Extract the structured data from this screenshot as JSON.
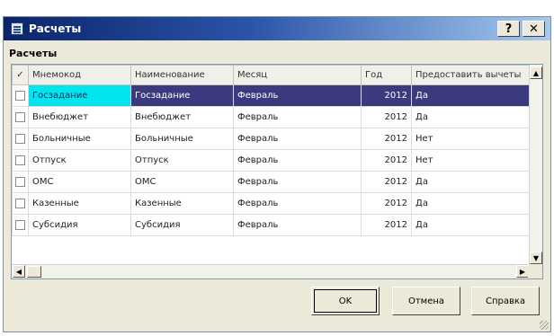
{
  "window": {
    "title": "Расчеты",
    "help_label": "?",
    "close_label": "✕",
    "icon": "app-grid-icon"
  },
  "section_label": "Расчеты",
  "grid": {
    "check_header": "✓",
    "columns": [
      "Мнемокод",
      "Наименование",
      "Месяц",
      "Год",
      "Предоставить вычеты"
    ],
    "rows": [
      {
        "mnemo": "Госзадание",
        "name": "Госзадание",
        "month": "Февраль",
        "year": "2012",
        "flag": "Да",
        "selected": true
      },
      {
        "mnemo": "Внебюджет",
        "name": "Внебюджет",
        "month": "Февраль",
        "year": "2012",
        "flag": "Да"
      },
      {
        "mnemo": "Больничные",
        "name": "Больничные",
        "month": "Февраль",
        "year": "2012",
        "flag": "Нет"
      },
      {
        "mnemo": "Отпуск",
        "name": "Отпуск",
        "month": "Февраль",
        "year": "2012",
        "flag": "Нет"
      },
      {
        "mnemo": "ОМС",
        "name": "ОМС",
        "month": "Февраль",
        "year": "2012",
        "flag": "Да"
      },
      {
        "mnemo": "Казенные",
        "name": "Казенные",
        "month": "Февраль",
        "year": "2012",
        "flag": "Да"
      },
      {
        "mnemo": "Субсидия",
        "name": "Субсидия",
        "month": "Февраль",
        "year": "2012",
        "flag": "Да"
      }
    ]
  },
  "buttons": {
    "ok": "OK",
    "cancel": "Отмена",
    "help": "Справка"
  },
  "colors": {
    "title_start": "#0a246a",
    "selection": "#3c3a7e",
    "focused_cell": "#00e5ee"
  }
}
